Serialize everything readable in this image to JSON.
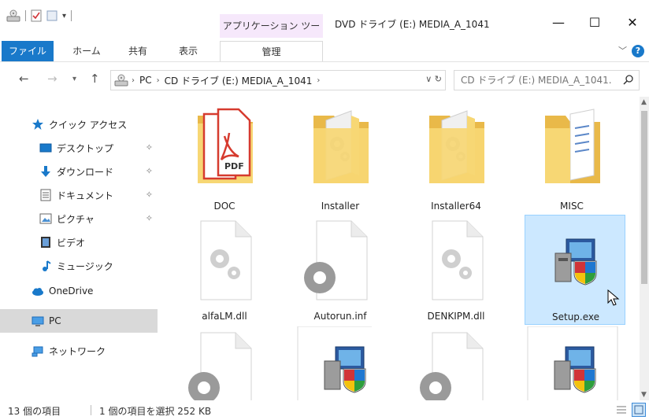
{
  "window": {
    "title": "DVD ドライブ (E:) MEDIA_A_1041",
    "tool_tab_header": "アプリケーション ツール",
    "minimize": "—",
    "maximize": "☐",
    "close": "✕"
  },
  "ribbon": {
    "tabs": [
      "ファイル",
      "ホーム",
      "共有",
      "表示",
      "管理"
    ],
    "help": "?"
  },
  "address": {
    "crumbs": [
      "PC",
      "CD ドライブ (E:) MEDIA_A_1041"
    ],
    "search_placeholder": "CD ドライブ (E:) MEDIA_A_1041..."
  },
  "nav": {
    "quick_access": "クイック アクセス",
    "desktop": "デスクトップ",
    "downloads": "ダウンロード",
    "documents": "ドキュメント",
    "pictures": "ピクチャ",
    "videos": "ビデオ",
    "music": "ミュージック",
    "onedrive": "OneDrive",
    "pc": "PC",
    "network": "ネットワーク"
  },
  "files": [
    {
      "name": "DOC",
      "kind": "folder-pdf"
    },
    {
      "name": "Installer",
      "kind": "folder-gear"
    },
    {
      "name": "Installer64",
      "kind": "folder-gear"
    },
    {
      "name": "MISC",
      "kind": "folder-doc"
    },
    {
      "name": "alfaLM.dll",
      "kind": "dll"
    },
    {
      "name": "Autorun.inf",
      "kind": "inf"
    },
    {
      "name": "DENKIPM.dll",
      "kind": "dll"
    },
    {
      "name": "Setup.exe",
      "kind": "installer",
      "selected": true
    }
  ],
  "status": {
    "count": "13 個の項目",
    "selection": "1 個の項目を選択 252 KB"
  },
  "colors": {
    "accent": "#1979ca",
    "selection": "#cce8ff",
    "selection_border": "#99d1ff",
    "folder": "#f7d774"
  }
}
